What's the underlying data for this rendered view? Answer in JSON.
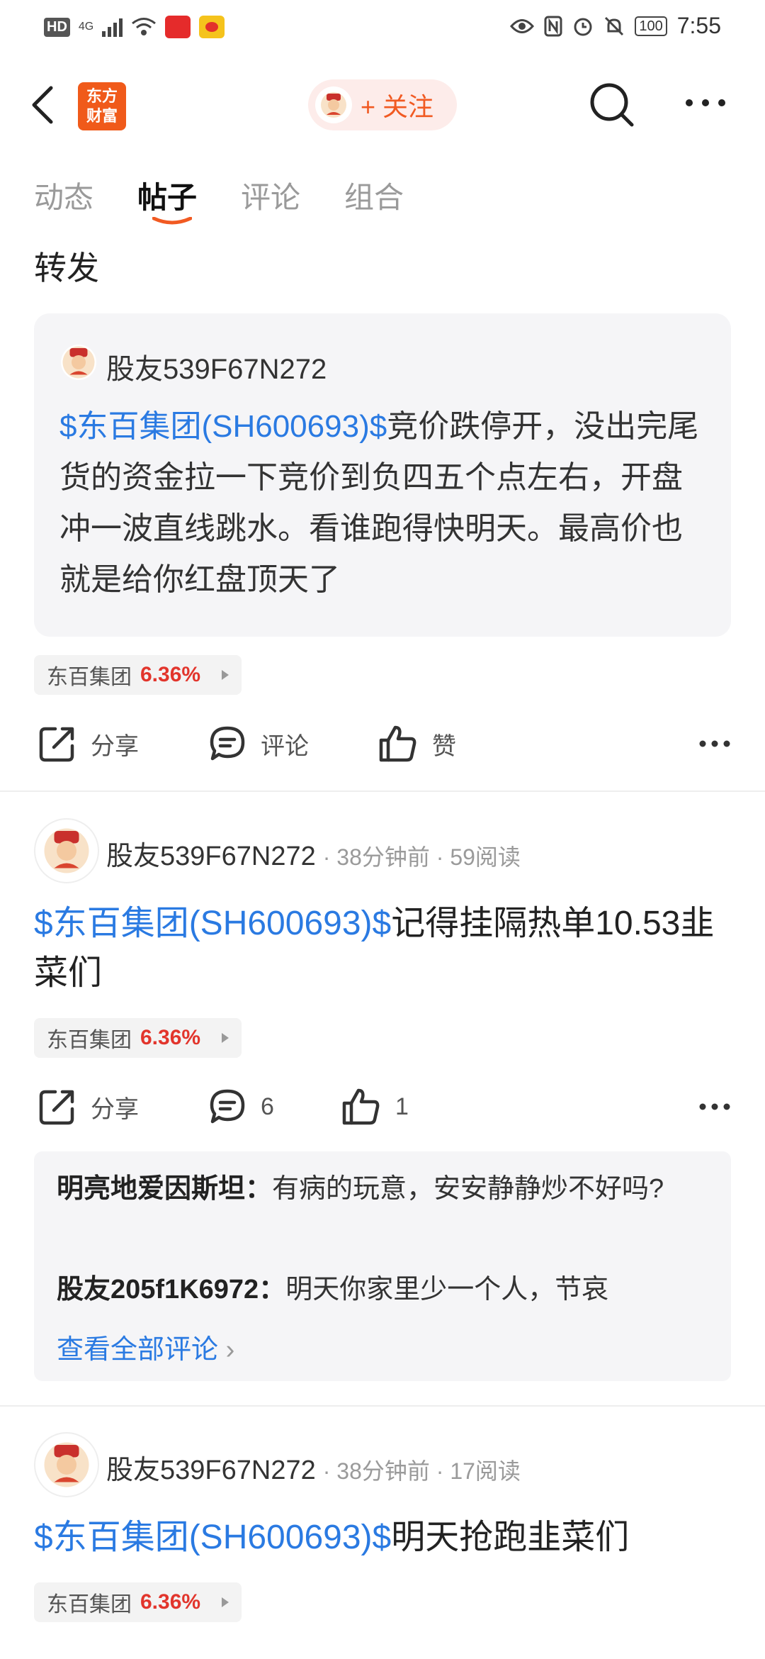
{
  "status_bar": {
    "hd_badge": "HD",
    "network": "4G",
    "time": "7:55",
    "battery": "100"
  },
  "header": {
    "app_logo": "东方\n财富",
    "follow_label": "+ 关注"
  },
  "tabs": [
    "动态",
    "帖子",
    "评论",
    "组合"
  ],
  "active_tab_index": 1,
  "repost_label": "转发",
  "quoted_post": {
    "user": "股友539F67N272",
    "link": "$东百集团(SH600693)$",
    "text": "竞价跌停开，没出完尾货的资金拉一下竞价到负四五个点左右，开盘冲一波直线跳水。看谁跑得快明天。最高价也就是给你红盘顶天了"
  },
  "repost_stock_chip": {
    "name": "东百集团",
    "pct": "6.36%"
  },
  "repost_actions": {
    "share": "分享",
    "comment": "评论",
    "like": "赞"
  },
  "post2": {
    "user": "股友539F67N272",
    "meta": "· 38分钟前 · 59阅读",
    "link": "$东百集团(SH600693)$",
    "text": "记得挂隔热单10.53韭菜们",
    "stock_chip": {
      "name": "东百集团",
      "pct": "6.36%"
    },
    "actions": {
      "share": "分享",
      "comment": "6",
      "like": "1"
    },
    "comments": [
      {
        "user": "明亮地爱因斯坦",
        "sep": "：",
        "text": "有病的玩意，安安静静炒不好吗?"
      },
      {
        "user": "股友205f1K6972",
        "sep": "：",
        "text": "明天你家里少一个人，节哀"
      }
    ],
    "view_all": "查看全部评论"
  },
  "post3": {
    "user": "股友539F67N272",
    "meta": "· 38分钟前 · 17阅读",
    "link": "$东百集团(SH600693)$",
    "text": "明天抢跑韭菜们",
    "stock_chip": {
      "name": "东百集团",
      "pct": "6.36%"
    }
  },
  "colors": {
    "accent": "#f15a22",
    "link": "#2a7ae2",
    "up": "#e2352c"
  }
}
